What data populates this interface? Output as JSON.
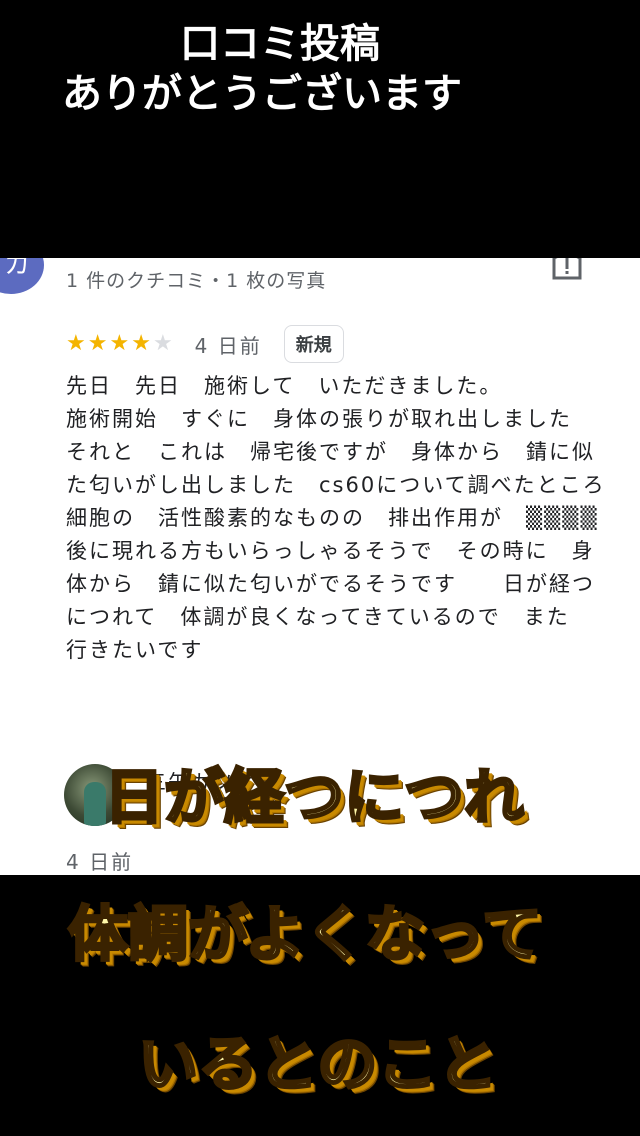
{
  "header": {
    "line1": "口コミ投稿",
    "line2": "ありがとうございます"
  },
  "review": {
    "avatar_initial": "カ",
    "meta": "1 件のクチコミ・1 枚の写真",
    "rating": 4,
    "rating_max": 5,
    "days_ago": "4 日前",
    "badge": "新規",
    "body": "先日　先日　施術して　いただきました。\n施術開始　すぐに　身体の張りが取れ出しました　　　　それと　これは　帰宅後ですが　身体から　錆に似た匂いがし出しました　cs60について調べたところ　細胞の　活性酸素的なものの　排出作用が　▒▒▒▒後に現れる方もいらっしゃるそうで　その時に　身体から　錆に似た匂いがでるそうです　　日が経つにつれて　体調が良くなってきているので　また　行きたいです"
  },
  "next_review": {
    "name": "三矢カツポニ",
    "days_ago": "4 日前"
  },
  "captions": {
    "line1": "日が経つにつれ",
    "line2": "体調がよくなって",
    "line3": "いるとのこと"
  },
  "colors": {
    "star": "#f4b400",
    "caption_fill": "#fff7a8",
    "caption_shadow": "#c98a00"
  }
}
